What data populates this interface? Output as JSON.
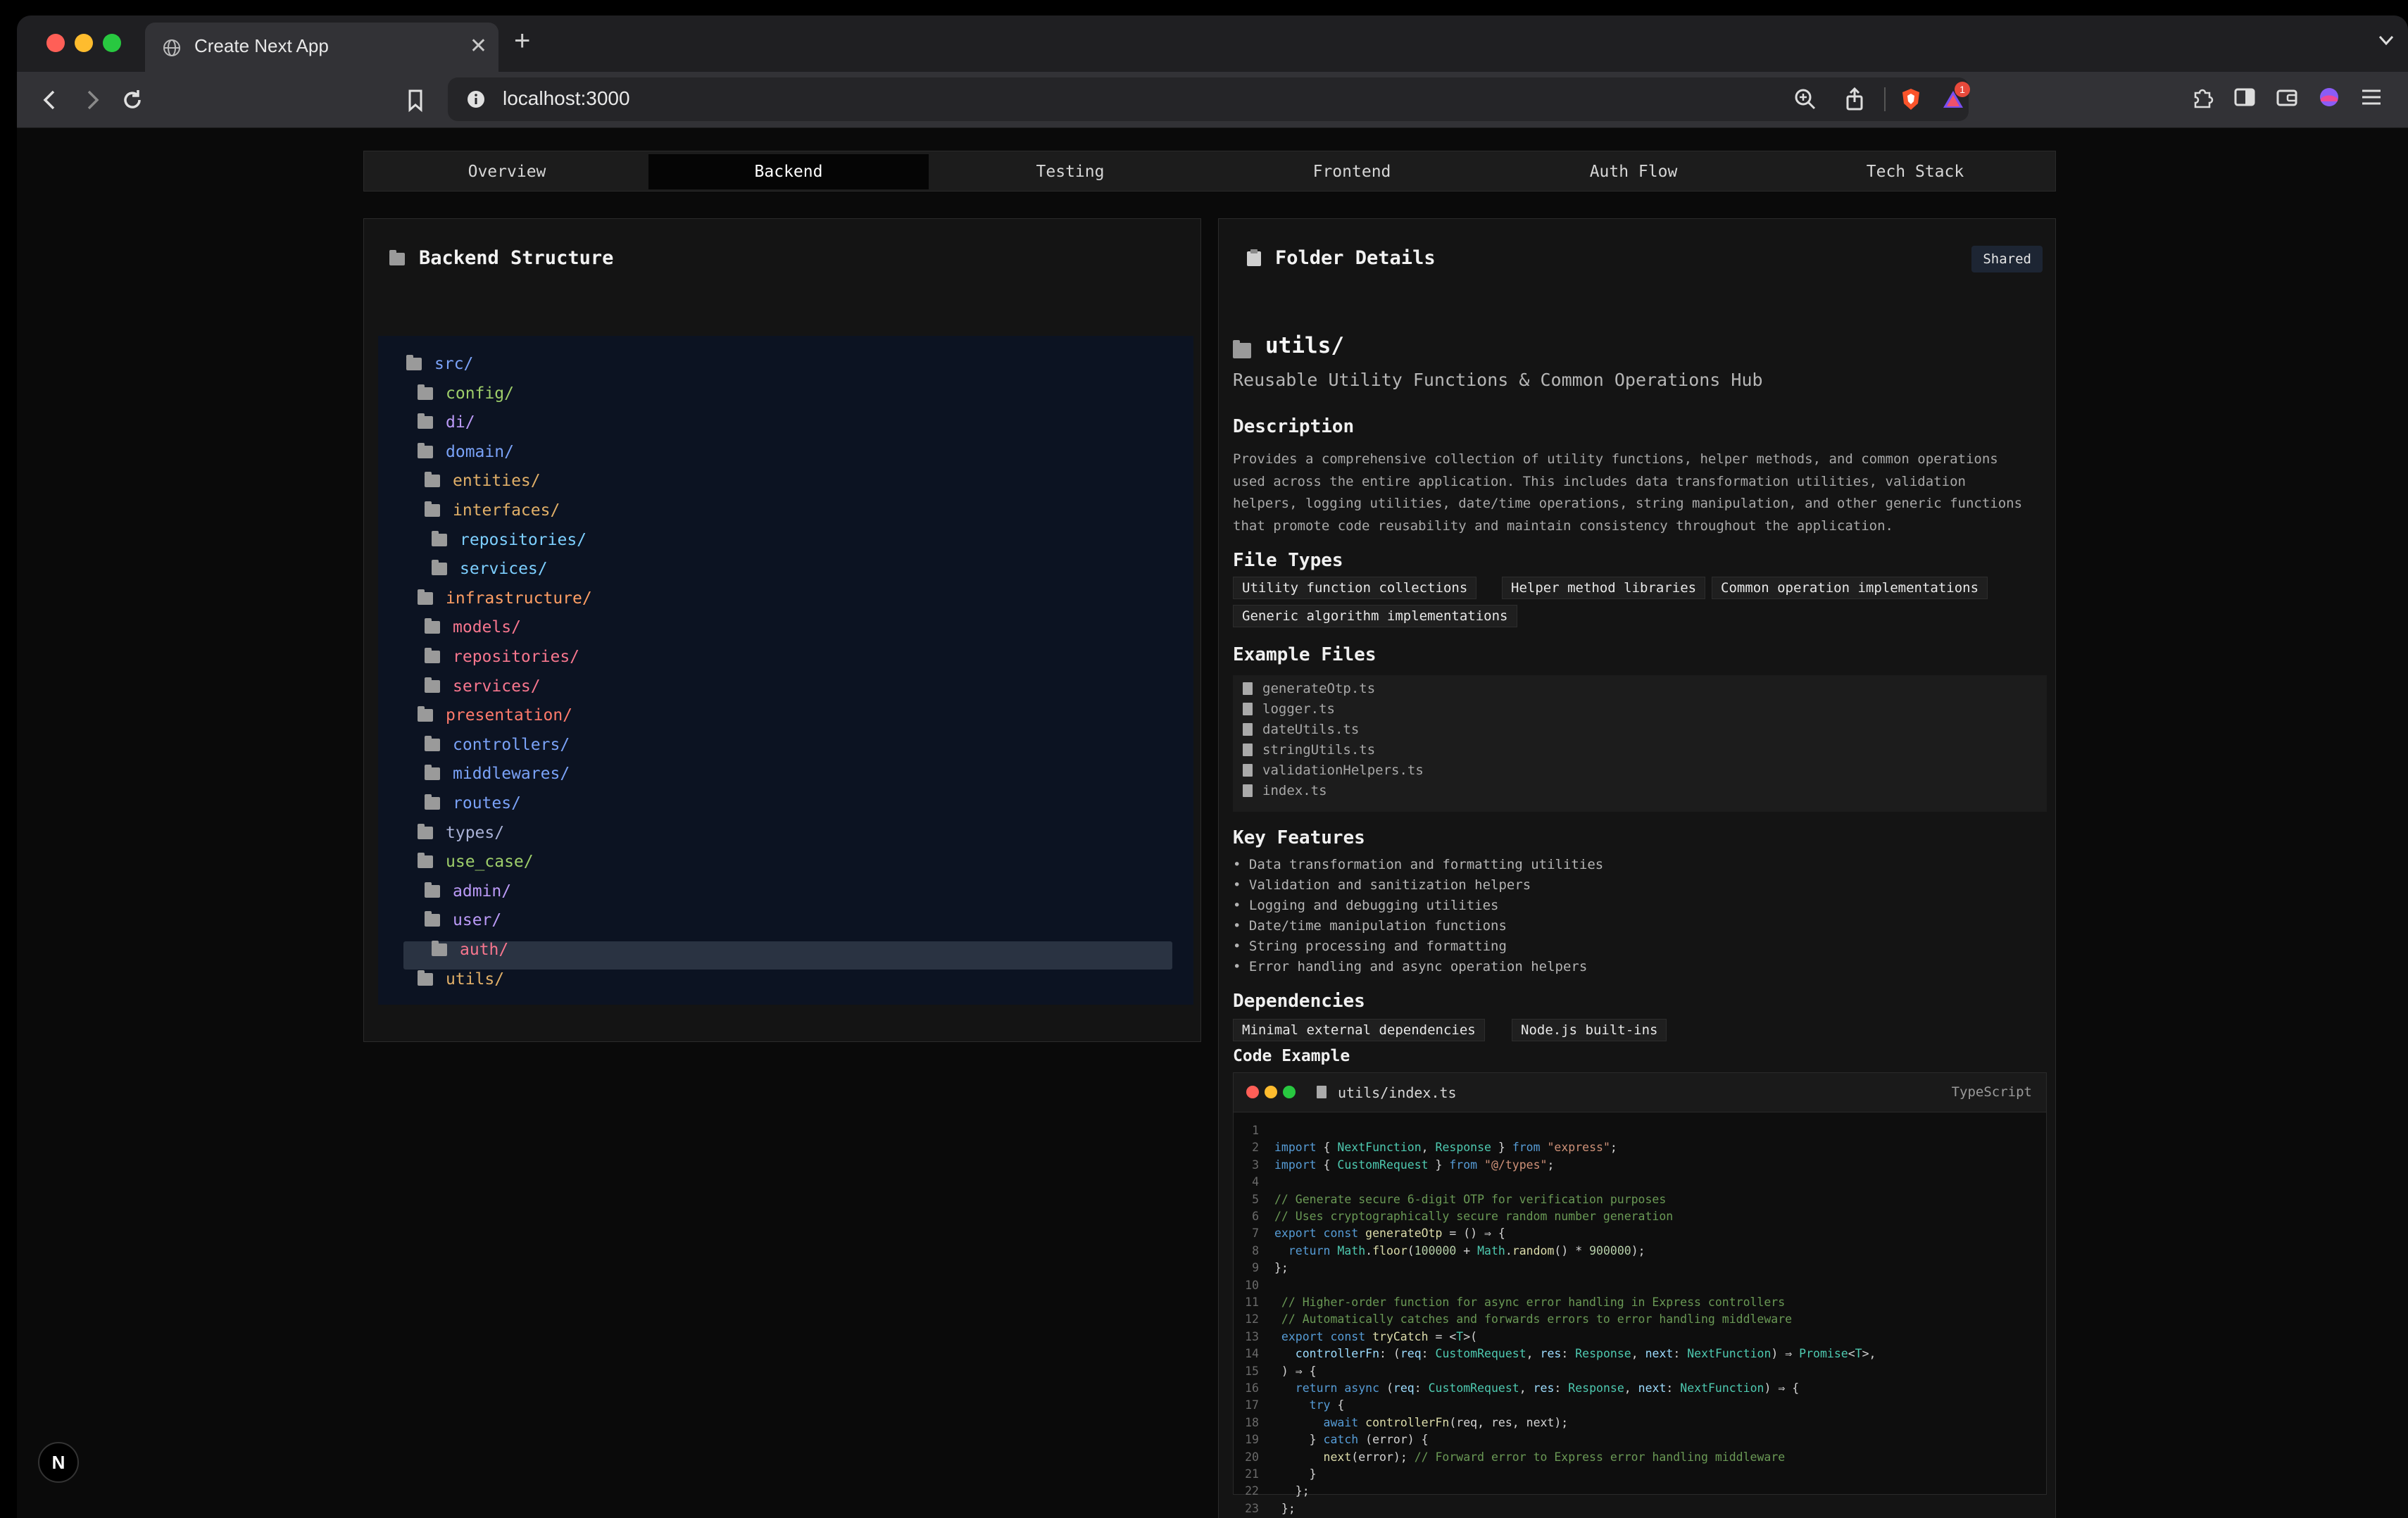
{
  "browser": {
    "tab_title": "Create Next App",
    "url": "localhost:3000",
    "notification_count": "1"
  },
  "nav_tabs": [
    "Overview",
    "Backend",
    "Testing",
    "Frontend",
    "Auth Flow",
    "Tech Stack"
  ],
  "active_tab": "Backend",
  "left_panel": {
    "title": "Backend Structure",
    "tree": [
      {
        "label": "src/",
        "color": "#7aa2f7"
      },
      {
        "label": "config/",
        "color": "#9ece6a"
      },
      {
        "label": "di/",
        "color": "#bb9af7"
      },
      {
        "label": "domain/",
        "color": "#7aa2f7"
      },
      {
        "label": "entities/",
        "color": "#e0af68"
      },
      {
        "label": "interfaces/",
        "color": "#e0af68"
      },
      {
        "label": "repositories/",
        "color": "#7dcfff"
      },
      {
        "label": "services/",
        "color": "#7dcfff"
      },
      {
        "label": "infrastructure/",
        "color": "#ff9e64"
      },
      {
        "label": "models/",
        "color": "#f7768e"
      },
      {
        "label": "repositories/",
        "color": "#f7768e"
      },
      {
        "label": "services/",
        "color": "#f7768e"
      },
      {
        "label": "presentation/",
        "color": "#ff7a6b"
      },
      {
        "label": "controllers/",
        "color": "#7aa2f7"
      },
      {
        "label": "middlewares/",
        "color": "#7aa2f7"
      },
      {
        "label": "routes/",
        "color": "#7aa2f7"
      },
      {
        "label": "types/",
        "color": "#a9b1d6"
      },
      {
        "label": "use_case/",
        "color": "#9ece6a"
      },
      {
        "label": "admin/",
        "color": "#bb9af7"
      },
      {
        "label": "user/",
        "color": "#bb9af7"
      },
      {
        "label": "auth/",
        "color": "#f7768e"
      },
      {
        "label": "utils/",
        "color": "#e0af68"
      }
    ]
  },
  "right_panel": {
    "title": "Folder Details",
    "badge": "Shared",
    "folder_name": "utils/",
    "subtitle": "Reusable Utility Functions & Common Operations Hub",
    "description_heading": "Description",
    "description_lines": [
      "Provides a comprehensive collection of utility functions, helper methods, and common operations",
      "used across the entire application. This includes data transformation utilities, validation",
      "helpers, logging utilities, date/time operations, string manipulation, and other generic functions",
      "that promote code reusability and maintain consistency throughout the application."
    ],
    "file_types_heading": "File Types",
    "file_types": [
      "Utility function collections",
      "Helper method libraries",
      "Common operation implementations",
      "Generic algorithm implementations"
    ],
    "example_files_heading": "Example Files",
    "example_files": [
      "generateOtp.ts",
      "logger.ts",
      "dateUtils.ts",
      "stringUtils.ts",
      "validationHelpers.ts",
      "index.ts"
    ],
    "key_features_heading": "Key Features",
    "key_features": [
      "• Data transformation and formatting utilities",
      "• Validation and sanitization helpers",
      "• Logging and debugging utilities",
      "• Date/time manipulation functions",
      "• String processing and formatting",
      "• Error handling and async operation helpers"
    ],
    "dependencies_heading": "Dependencies",
    "dependencies": [
      "Minimal external dependencies",
      "Node.js built-ins"
    ],
    "code_heading": "Code Example",
    "code_file": "utils/index.ts",
    "code_lang": "TypeScript"
  },
  "code_lines": [
    [],
    [
      [
        "k",
        "import"
      ],
      [
        "p",
        " { "
      ],
      [
        "t",
        "NextFunction"
      ],
      [
        "p",
        ", "
      ],
      [
        "t",
        "Response"
      ],
      [
        "p",
        " } "
      ],
      [
        "k",
        "from"
      ],
      [
        "s",
        " \"express\""
      ],
      [
        "p",
        ";"
      ]
    ],
    [
      [
        "k",
        "import"
      ],
      [
        "p",
        " { "
      ],
      [
        "t",
        "CustomRequest"
      ],
      [
        "p",
        " } "
      ],
      [
        "k",
        "from"
      ],
      [
        "s",
        " \"@/types\""
      ],
      [
        "p",
        ";"
      ]
    ],
    [],
    [
      [
        "c",
        "// Generate secure 6-digit OTP for verification purposes"
      ]
    ],
    [
      [
        "c",
        "// Uses cryptographically secure random number generation"
      ]
    ],
    [
      [
        "k",
        "export const"
      ],
      [
        "f",
        " generateOtp"
      ],
      [
        "p",
        " = () ⇒ {"
      ]
    ],
    [
      [
        "k",
        "  return "
      ],
      [
        "t",
        "Math"
      ],
      [
        "p",
        "."
      ],
      [
        "f",
        "floor"
      ],
      [
        "p",
        "("
      ],
      [
        "n",
        "100000"
      ],
      [
        "p",
        " + "
      ],
      [
        "t",
        "Math"
      ],
      [
        "p",
        "."
      ],
      [
        "f",
        "random"
      ],
      [
        "p",
        "() * "
      ],
      [
        "n",
        "900000"
      ],
      [
        "p",
        ");"
      ]
    ],
    [
      [
        "p",
        "};"
      ]
    ],
    [],
    [
      [
        "c",
        " // Higher-order function for async error handling in Express controllers"
      ]
    ],
    [
      [
        "c",
        " // Automatically catches and forwards errors to error handling middleware"
      ]
    ],
    [
      [
        "k",
        " export const"
      ],
      [
        "f",
        " tryCatch"
      ],
      [
        "p",
        " = <"
      ],
      [
        "t",
        "T"
      ],
      [
        "p",
        ">("
      ]
    ],
    [
      [
        "v",
        "   controllerFn"
      ],
      [
        "p",
        ": ("
      ],
      [
        "v",
        "req"
      ],
      [
        "p",
        ": "
      ],
      [
        "t",
        "CustomRequest"
      ],
      [
        "p",
        ", "
      ],
      [
        "v",
        "res"
      ],
      [
        "p",
        ": "
      ],
      [
        "t",
        "Response"
      ],
      [
        "p",
        ", "
      ],
      [
        "v",
        "next"
      ],
      [
        "p",
        ": "
      ],
      [
        "t",
        "NextFunction"
      ],
      [
        "p",
        ") ⇒ "
      ],
      [
        "t",
        "Promise"
      ],
      [
        "p",
        "<"
      ],
      [
        "t",
        "T"
      ],
      [
        "p",
        ">,"
      ]
    ],
    [
      [
        "p",
        " ) ⇒ {"
      ]
    ],
    [
      [
        "k",
        "   return async"
      ],
      [
        "p",
        " ("
      ],
      [
        "v",
        "req"
      ],
      [
        "p",
        ": "
      ],
      [
        "t",
        "CustomRequest"
      ],
      [
        "p",
        ", "
      ],
      [
        "v",
        "res"
      ],
      [
        "p",
        ": "
      ],
      [
        "t",
        "Response"
      ],
      [
        "p",
        ", "
      ],
      [
        "v",
        "next"
      ],
      [
        "p",
        ": "
      ],
      [
        "t",
        "NextFunction"
      ],
      [
        "p",
        ") ⇒ {"
      ]
    ],
    [
      [
        "k",
        "     try"
      ],
      [
        "p",
        " {"
      ]
    ],
    [
      [
        "k",
        "       await"
      ],
      [
        "f",
        " controllerFn"
      ],
      [
        "p",
        "(req, res, next);"
      ]
    ],
    [
      [
        "p",
        "     } "
      ],
      [
        "k",
        "catch"
      ],
      [
        "p",
        " (error) {"
      ]
    ],
    [
      [
        "f",
        "       next"
      ],
      [
        "p",
        "(error); "
      ],
      [
        "c",
        "// Forward error to Express error handling middleware"
      ]
    ],
    [
      [
        "p",
        "     }"
      ]
    ],
    [
      [
        "p",
        "   };"
      ]
    ],
    [
      [
        "p",
        " };"
      ]
    ]
  ]
}
